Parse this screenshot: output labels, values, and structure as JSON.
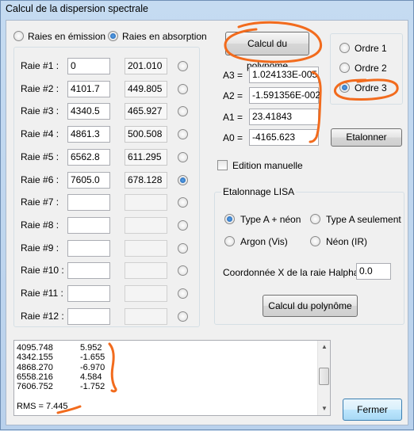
{
  "window": {
    "title": "Calcul de la dispersion spectrale"
  },
  "mode": {
    "emission_label": "Raies en émission",
    "absorption_label": "Raies en absorption",
    "selected": "absorption"
  },
  "raies": [
    {
      "label": "Raie #1 :",
      "wavelength": "0",
      "pixel": "201.010",
      "selected": false
    },
    {
      "label": "Raie #2 :",
      "wavelength": "4101.7",
      "pixel": "449.805",
      "selected": false
    },
    {
      "label": "Raie #3 :",
      "wavelength": "4340.5",
      "pixel": "465.927",
      "selected": false
    },
    {
      "label": "Raie #4 :",
      "wavelength": "4861.3",
      "pixel": "500.508",
      "selected": false
    },
    {
      "label": "Raie #5 :",
      "wavelength": "6562.8",
      "pixel": "611.295",
      "selected": false
    },
    {
      "label": "Raie #6 :",
      "wavelength": "7605.0",
      "pixel": "678.128",
      "selected": true
    },
    {
      "label": "Raie #7 :",
      "wavelength": "",
      "pixel": "",
      "selected": false
    },
    {
      "label": "Raie #8 :",
      "wavelength": "",
      "pixel": "",
      "selected": false
    },
    {
      "label": "Raie #9 :",
      "wavelength": "",
      "pixel": "",
      "selected": false
    },
    {
      "label": "Raie #10 :",
      "wavelength": "",
      "pixel": "",
      "selected": false
    },
    {
      "label": "Raie #11 :",
      "wavelength": "",
      "pixel": "",
      "selected": false
    },
    {
      "label": "Raie #12 :",
      "wavelength": "",
      "pixel": "",
      "selected": false
    }
  ],
  "polynome": {
    "button_label": "Calcul du polynôme",
    "coefficients": [
      {
        "label": "A3 =",
        "value": "1.024133E-005"
      },
      {
        "label": "A2 =",
        "value": "-1.591356E-002"
      },
      {
        "label": "A1 =",
        "value": "23.41843"
      },
      {
        "label": "A0 =",
        "value": "-4165.623"
      }
    ]
  },
  "ordre": {
    "options": [
      "Ordre 1",
      "Ordre 2",
      "Ordre 3"
    ],
    "selected": 2
  },
  "etalonner_label": "Etalonner",
  "edition_manuelle_label": "Edition manuelle",
  "lisa": {
    "group_title": "Etalonnage LISA",
    "options": [
      "Type A + néon",
      "Type A seulement",
      "Argon (Vis)",
      "Néon (IR)"
    ],
    "selected": 0,
    "halpha_label": "Coordonnée X de la raie Halpha :",
    "halpha_value": "0.0",
    "button_label": "Calcul du polynôme"
  },
  "results": {
    "rows": [
      {
        "a": "4095.748",
        "b": "5.952"
      },
      {
        "a": "4342.155",
        "b": "-1.655"
      },
      {
        "a": "4868.270",
        "b": "-6.970"
      },
      {
        "a": "6558.216",
        "b": "4.584"
      },
      {
        "a": "7606.752",
        "b": "-1.752"
      }
    ],
    "rms": "RMS = 7.445"
  },
  "fermer_label": "Fermer",
  "annotation_color": "#f26b1d"
}
